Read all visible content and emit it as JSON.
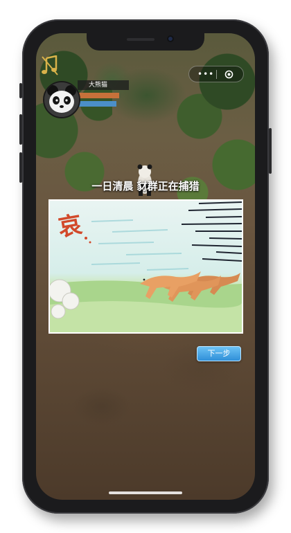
{
  "player": {
    "name": "大熊猫"
  },
  "story": {
    "caption": "一日清晨 豺群正在捕猎",
    "comic_sfx": "哀",
    "next_label": "下一步"
  },
  "mini_program": {
    "menu_glyph": "•••"
  },
  "colors": {
    "hp_bar": "#c7713a",
    "energy_bar": "#4b8fc8",
    "next_button": "#2f8fd8"
  }
}
